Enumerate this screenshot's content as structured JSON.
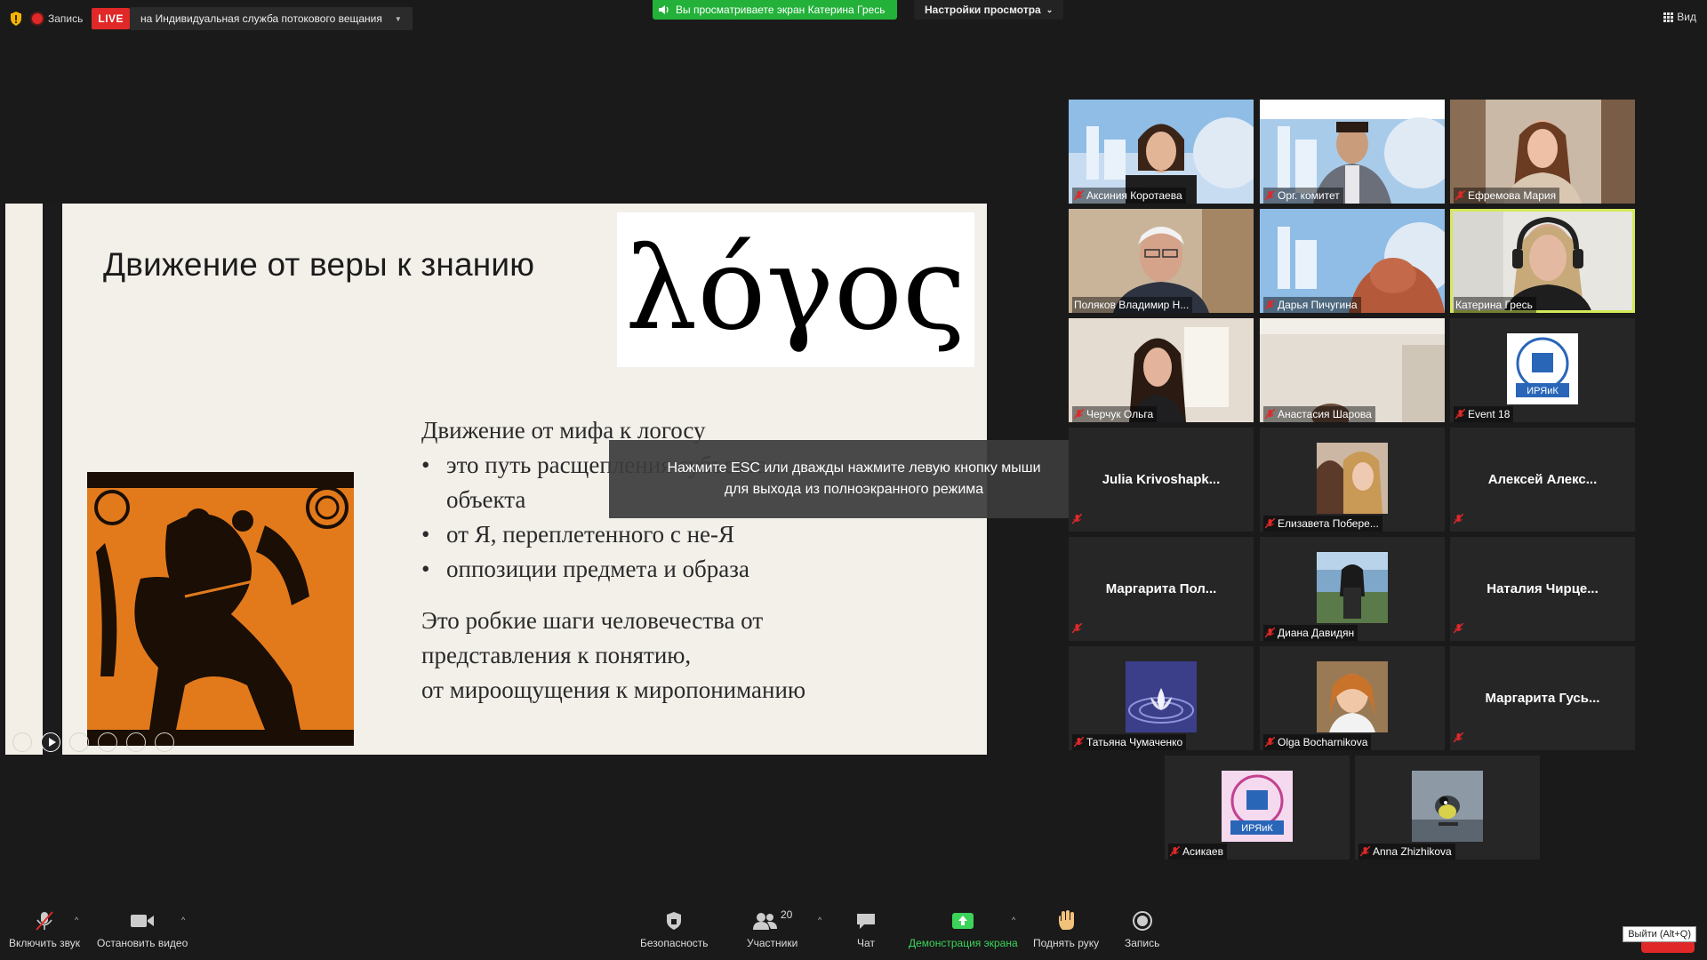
{
  "top": {
    "record_label": "Запись",
    "live_label": "LIVE",
    "stream_target": "на Индивидуальная служба потокового вещания",
    "viewing_banner": "Вы просматриваете экран Катерина Гресь",
    "view_settings": "Настройки просмотра",
    "view_label": "Вид"
  },
  "slide": {
    "title": "Движение от веры к знанию",
    "logos": "λόγος",
    "heading": "Движение от мифа к логосу",
    "bullet1_a": "это путь расщепления субъекта и",
    "bullet1_b": "объекта",
    "bullet2": "от Я, переплетенного с не-Я",
    "bullet3": "оппозиции предмета и образа",
    "para1": "Это робкие шаги человечества от",
    "para2": "представления к понятию,",
    "para3": "от мироощущения к миропониманию"
  },
  "toast": {
    "line1": "Нажмите ESC или дважды нажмите левую кнопку мыши",
    "line2": "для выхода из полноэкранного режима"
  },
  "participants": [
    {
      "name": "Аксиния Коротаева",
      "kind": "video"
    },
    {
      "name": "Орг. комитет",
      "kind": "video"
    },
    {
      "name": "Ефремова Мария",
      "kind": "video"
    },
    {
      "name": "Поляков Владимир Н...",
      "kind": "video"
    },
    {
      "name": "Дарья Пичугина",
      "kind": "video"
    },
    {
      "name": "Катерина Гресь",
      "kind": "video",
      "active": true
    },
    {
      "name": "Черчук Ольга",
      "kind": "video"
    },
    {
      "name": "Анастасия Шарова",
      "kind": "video"
    },
    {
      "name": "Event 18",
      "kind": "avatar"
    },
    {
      "name": "Julia Krivoshapk...",
      "kind": "text"
    },
    {
      "name": "Елизавета Побере...",
      "kind": "avatar"
    },
    {
      "name": "Алексей Алекс...",
      "kind": "text"
    },
    {
      "name": "Маргарита Пол...",
      "kind": "text"
    },
    {
      "name": "Диана Давидян",
      "kind": "avatar"
    },
    {
      "name": "Наталия Чирце...",
      "kind": "text"
    },
    {
      "name": "Татьяна Чумаченко",
      "kind": "avatar"
    },
    {
      "name": "Olga Bocharnikova",
      "kind": "avatar"
    },
    {
      "name": "Маргарита Гусь...",
      "kind": "text"
    },
    {
      "name": "Асикаев",
      "kind": "avatar"
    },
    {
      "name": "Anna Zhizhikova",
      "kind": "avatar"
    }
  ],
  "toolbar": {
    "unmute": "Включить звук",
    "stop_video": "Остановить видео",
    "security": "Безопасность",
    "participants": "Участники",
    "participants_count": "20",
    "chat": "Чат",
    "share_screen": "Демонстрация экрана",
    "raise_hand": "Поднять руку",
    "record": "Запись",
    "exit_tip": "Выйти (Alt+Q)"
  },
  "colors": {
    "accent_green": "#23b13a",
    "live_red": "#e02828",
    "active_speaker": "#d4e85a"
  }
}
